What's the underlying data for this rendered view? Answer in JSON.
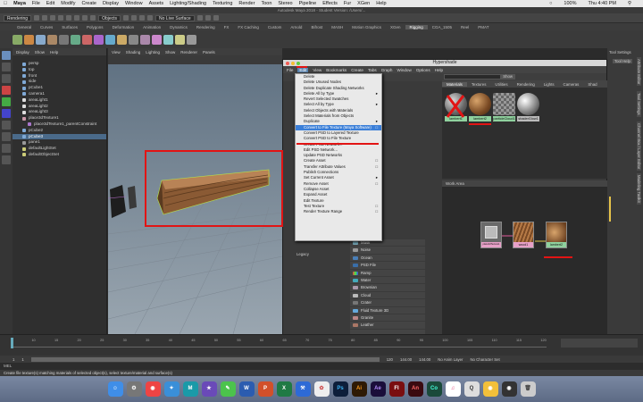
{
  "menubar": {
    "apple": "",
    "app": "Maya",
    "items": [
      "File",
      "Edit",
      "Modify",
      "Create",
      "Display",
      "Window",
      "Assets",
      "Lighting/Shading",
      "Texturing",
      "Render",
      "Toon",
      "Stereo",
      "Pipeline",
      "Effects",
      "Fur",
      "XGen",
      "Help"
    ],
    "battery": "100%",
    "time": "Thu 4:40 PM"
  },
  "title": "Autodesk Maya 2018 - Student Version: /Users/...",
  "row1": {
    "menuset": "Rendering",
    "objects": "Objects",
    "live": "No Live Surface"
  },
  "shelf_tabs": [
    "General",
    "Curves",
    "Surfaces",
    "Polygons",
    "Deformation",
    "Animation",
    "Dynamics",
    "Rendering",
    "FX",
    "FX Caching",
    "Custom",
    "Arnold",
    "Bifrost",
    "MASH",
    "Motion Graphics",
    "XGen",
    "Rigging",
    "CGA_1505",
    "Reel",
    "PMAT"
  ],
  "shelf_active": "Rigging",
  "outliner": {
    "menus": [
      "Display",
      "Show",
      "Help"
    ],
    "items": [
      "persp",
      "top",
      "front",
      "side",
      "pCube1",
      "camera1",
      "areaLight1",
      "areaLight2",
      "areaLight3",
      "place3dTexture1",
      "place3dTexture1_parentConstraint",
      "pCube2",
      "pCube3",
      "pane1",
      "defaultLightSet",
      "defaultObjectSet"
    ],
    "selected": "pCube3"
  },
  "viewport": {
    "menus": [
      "View",
      "Shading",
      "Lighting",
      "Show",
      "Renderer",
      "Panels"
    ]
  },
  "hypershade": {
    "title": "Hypershade",
    "menus": [
      "File",
      "Edit",
      "View",
      "Bookmarks",
      "Create",
      "Tabs",
      "Graph",
      "Window",
      "Options",
      "Help"
    ],
    "active_menu": "Edit",
    "show_button": "Show"
  },
  "edit_menu": [
    "Delete",
    "Delete Unused Nodes",
    "Delete Duplicate Shading Networks",
    "Delete All by Type",
    "Revert Selected Swatches",
    "Select All by Type",
    "Select Objects with Materials",
    "Select Materials from Objects",
    "Duplicate",
    "Convert to File Texture (Maya Software)",
    "Convert PSD to Layered Texture",
    "Convert PSD to File Texture",
    "Create PSD Network...",
    "Edit PSD Network...",
    "Update PSD Networks",
    "Create Asset",
    "Transfer Attribute Values",
    "Publish Connections",
    "Set Current Asset",
    "Remove Asset",
    "Collapse Asset",
    "Expand Asset",
    "Edit Texture",
    "Test Texture",
    "Render Texture Range"
  ],
  "edit_menu_highlight": "Convert to File Texture (Maya Software)",
  "legacy_label": "Legacy",
  "node_list": [
    "Mask",
    "Noise",
    "Ocean",
    "PSD File",
    "Ramp",
    "Water",
    "Brownian",
    "Cloud",
    "Crater",
    "Fluid Texture 3D",
    "Granite",
    "Leather"
  ],
  "browser": {
    "tabs": [
      "Materials",
      "Textures",
      "Utilities",
      "Rendering",
      "Lights",
      "Cameras",
      "Shad"
    ],
    "swatches": [
      "lambert1",
      "lambert2",
      "particleCloud1",
      "shaderGlow1"
    ],
    "work_area": "Work Area"
  },
  "nodes": [
    "place3dTexture1",
    "wood1",
    "lambert2"
  ],
  "right_tabs": [
    "Attribute Editor",
    "Tool Settings",
    "Channel Box / Layer Editor",
    "Modeling Toolkit"
  ],
  "right_labels": {
    "tool_settings": "Tool Settings",
    "tool_help": "Tool Help"
  },
  "timeline": {
    "ticks": [
      "5",
      "10",
      "15",
      "20",
      "25",
      "30",
      "35",
      "40",
      "45",
      "50",
      "55",
      "60",
      "65",
      "70",
      "75",
      "80",
      "85",
      "90",
      "95",
      "100",
      "105",
      "110",
      "115",
      "120"
    ],
    "start": "1",
    "end": "120",
    "range_end": "144.00",
    "range_end2": "144.00",
    "anim_layer": "No Anim Layer",
    "char_set": "No Character Set",
    "fps": "24 fps"
  },
  "mel_label": "MEL",
  "help_line": "Create file texture(s) matching materials of selected object(s), select texture/material and surface(s)",
  "dock": [
    "Finder",
    "Launchpad",
    "Chrome",
    "Safari",
    "Maya",
    "iMovie",
    "Messages",
    "Word",
    "PowerPoint",
    "Excel",
    "Xcode",
    "Photos",
    "Photoshop",
    "Illustrator",
    "After Effects",
    "Flash",
    "Animate",
    "Capture",
    "Music",
    "QuickTime",
    "Trash"
  ]
}
